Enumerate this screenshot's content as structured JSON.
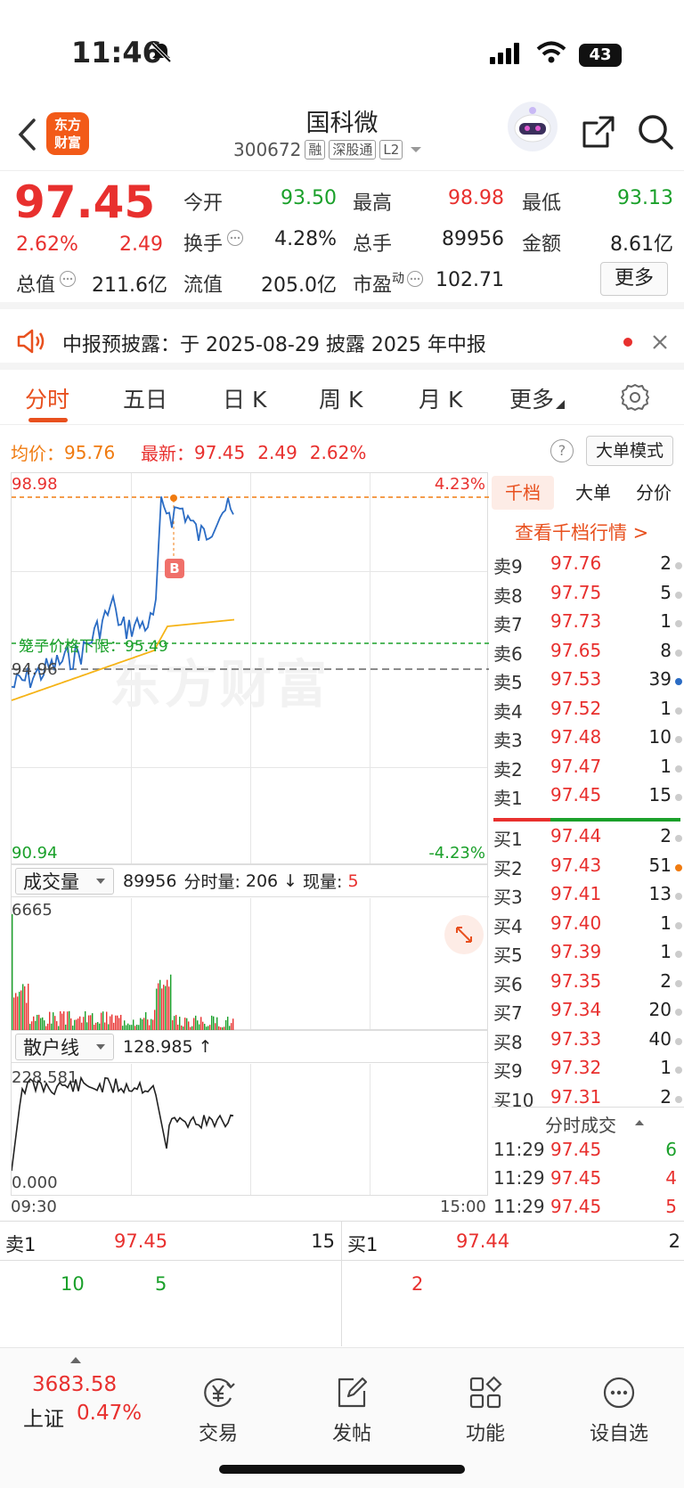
{
  "status_bar": {
    "time": "11:46",
    "battery": "43"
  },
  "header": {
    "logo_line1": "东方",
    "logo_line2": "财富",
    "stock_name": "国科微",
    "stock_code": "300672",
    "tags": [
      "融",
      "深股通",
      "L2"
    ]
  },
  "quote": {
    "price": "97.45",
    "change_pct": "2.62%",
    "change": "2.49",
    "open_label": "今开",
    "open": "93.50",
    "high_label": "最高",
    "high": "98.98",
    "low_label": "最低",
    "low": "93.13",
    "turnover_label": "换手",
    "turnover": "4.28%",
    "volume_label": "总手",
    "volume": "89956",
    "amount_label": "金额",
    "amount": "8.61亿",
    "mcap_label": "总值",
    "mcap": "211.6亿",
    "float_label": "流值",
    "float_mcap": "205.0亿",
    "pe_label": "市盈",
    "pe_sup": "动",
    "pe": "102.71",
    "more_label": "更多"
  },
  "notice": {
    "text": "中报预披露：于 2025-08-29 披露 2025 年中报"
  },
  "tabs": [
    {
      "label": "分时"
    },
    {
      "label": "五日"
    },
    {
      "label": "日 K"
    },
    {
      "label": "周 K"
    },
    {
      "label": "月 K"
    },
    {
      "label": "更多"
    }
  ],
  "infoline": {
    "avg_label": "均价：",
    "avg": "95.76",
    "latest_label": "最新：",
    "latest": "97.45",
    "change": "2.49",
    "change_pct": "2.62%",
    "help": "?",
    "bigorder_mode": "大单模式"
  },
  "price_chart": {
    "high_label": "98.98",
    "high_pct": "4.23%",
    "low_label": "90.94",
    "low_pct": "-4.23%",
    "prev_close": "94.96",
    "cage_label": "笼子价格下限：95.49",
    "watermark": "东方财富",
    "marker": "B"
  },
  "volume_chart": {
    "selector": "成交量",
    "total": "89956",
    "tick_label": "分时量:",
    "tick_value": "206",
    "tick_arrow": "↓",
    "now_label": "现量:",
    "now_value": "5",
    "max_label": "6665"
  },
  "retail_chart": {
    "selector": "散户线",
    "value": "128.985 ↑",
    "max_label": "228.581",
    "min_label": "0.000",
    "time_start": "09:30",
    "time_end": "15:00"
  },
  "orderbook": {
    "tabs": [
      "千档",
      "大单",
      "分价"
    ],
    "link": "查看千档行情 >",
    "asks": [
      {
        "label": "卖9",
        "price": "97.76",
        "vol": "2"
      },
      {
        "label": "卖8",
        "price": "97.75",
        "vol": "5"
      },
      {
        "label": "卖7",
        "price": "97.73",
        "vol": "1"
      },
      {
        "label": "卖6",
        "price": "97.65",
        "vol": "8"
      },
      {
        "label": "卖5",
        "price": "97.53",
        "vol": "39"
      },
      {
        "label": "卖4",
        "price": "97.52",
        "vol": "1"
      },
      {
        "label": "卖3",
        "price": "97.48",
        "vol": "10"
      },
      {
        "label": "卖2",
        "price": "97.47",
        "vol": "1"
      },
      {
        "label": "卖1",
        "price": "97.45",
        "vol": "15"
      }
    ],
    "bids": [
      {
        "label": "买1",
        "price": "97.44",
        "vol": "2"
      },
      {
        "label": "买2",
        "price": "97.43",
        "vol": "51"
      },
      {
        "label": "买3",
        "price": "97.41",
        "vol": "13"
      },
      {
        "label": "买4",
        "price": "97.40",
        "vol": "1"
      },
      {
        "label": "买5",
        "price": "97.39",
        "vol": "1"
      },
      {
        "label": "买6",
        "price": "97.35",
        "vol": "2"
      },
      {
        "label": "买7",
        "price": "97.34",
        "vol": "20"
      },
      {
        "label": "买8",
        "price": "97.33",
        "vol": "40"
      },
      {
        "label": "买9",
        "price": "97.32",
        "vol": "1"
      },
      {
        "label": "买10",
        "price": "97.31",
        "vol": "2"
      }
    ],
    "trades_title": "分时成交",
    "trades": [
      {
        "time": "11:29",
        "price": "97.45",
        "vol": "6"
      },
      {
        "time": "11:29",
        "price": "97.45",
        "vol": "4"
      },
      {
        "time": "11:29",
        "price": "97.45",
        "vol": "5"
      }
    ]
  },
  "bottom_book": {
    "ask_label": "卖1",
    "ask_price": "97.45",
    "ask_vol": "15",
    "bid_label": "买1",
    "bid_price": "97.44",
    "bid_vol": "2",
    "ask_detail": [
      "10",
      "5"
    ],
    "bid_detail": [
      "2"
    ]
  },
  "bottom_nav": {
    "index_value": "3683.58",
    "index_name": "上证",
    "index_pct": "0.47%",
    "items": [
      {
        "label": "交易",
        "icon": "trade-yen-icon"
      },
      {
        "label": "发帖",
        "icon": "post-edit-icon"
      },
      {
        "label": "功能",
        "icon": "grid-apps-icon"
      },
      {
        "label": "设自选",
        "icon": "more-dots-icon"
      }
    ]
  },
  "colors": {
    "up": "#e8302e",
    "down": "#1aa02a",
    "accent": "#e8501e",
    "price_line": "#2b6cc4",
    "avg_line": "#f5b316"
  }
}
